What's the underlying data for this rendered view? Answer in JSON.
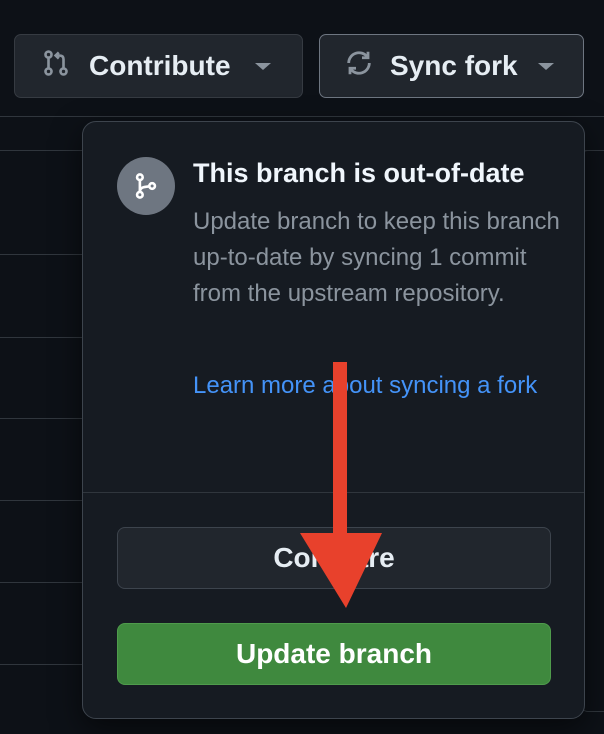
{
  "header": {
    "contribute_label": "Contribute",
    "sync_label": "Sync fork"
  },
  "popover": {
    "title": "This branch is out-of-date",
    "description": "Update branch to keep this branch up-to-date by syncing 1 commit from the upstream repository.",
    "learn_more_link": "Learn more about syncing a fork",
    "compare_label": "Compare",
    "update_label": "Update branch"
  },
  "annotation": {
    "arrow_color": "#e8412c"
  },
  "colors": {
    "background": "#0d1117",
    "popover_bg": "#161b22",
    "link": "#4493f8",
    "primary_button": "#3f893e"
  },
  "icons": {
    "contribute": "git-pull-request-icon",
    "sync": "sync-icon",
    "popover": "git-branch-icon",
    "dropdown": "triangle-down-icon"
  }
}
